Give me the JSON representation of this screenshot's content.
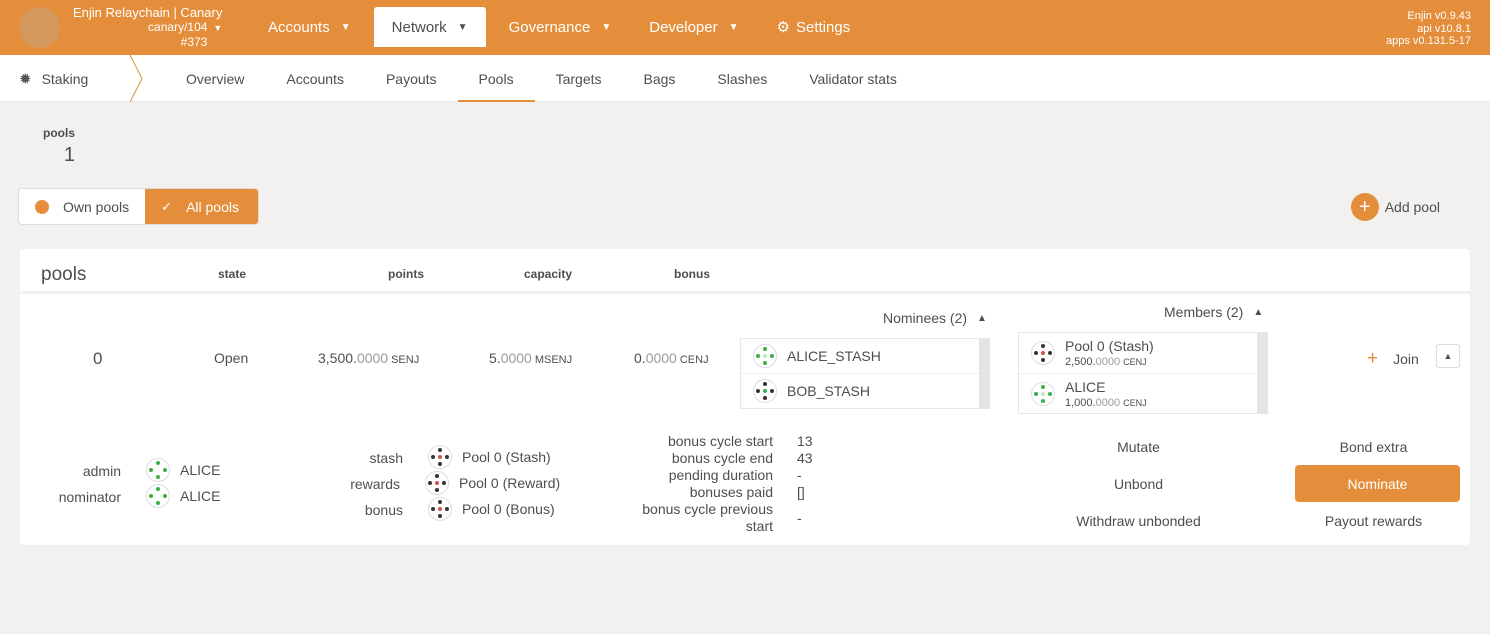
{
  "header": {
    "chain_name": "Enjin Relaychain | Canary",
    "runtime": "canary/104",
    "block": "#373",
    "menu": [
      {
        "label": "Accounts"
      },
      {
        "label": "Network"
      },
      {
        "label": "Governance"
      },
      {
        "label": "Developer"
      },
      {
        "label": "Settings"
      }
    ],
    "versions": [
      "Enjin v0.9.43",
      "api v10.8.1",
      "apps v0.131.5-17"
    ],
    "accent_color": "#e48e3b"
  },
  "subnav": {
    "section": "Staking",
    "tabs": [
      "Overview",
      "Accounts",
      "Payouts",
      "Pools",
      "Targets",
      "Bags",
      "Slashes",
      "Validator stats"
    ],
    "active_tab": "Pools"
  },
  "summary": {
    "label": "pools",
    "value": "1"
  },
  "filter": {
    "own": "Own pools",
    "all": "All pools",
    "selected": "All pools"
  },
  "add_pool": "Add pool",
  "table": {
    "title": "pools",
    "headers": {
      "state": "state",
      "points": "points",
      "capacity": "capacity",
      "bonus": "bonus"
    },
    "row": {
      "id": "0",
      "state": "Open",
      "points": {
        "int": "3,500.",
        "dec": "0000",
        "unit": "SENJ"
      },
      "capacity": {
        "int": "5.",
        "dec": "0000",
        "unit": "MSENJ"
      },
      "bonus": {
        "int": "0.",
        "dec": "0000",
        "unit": "CENJ"
      },
      "nominees_label": "Nominees (2)",
      "nominees": [
        "ALICE_STASH",
        "BOB_STASH"
      ],
      "members_label": "Members (2)",
      "members": [
        {
          "name": "Pool 0 (Stash)",
          "int": "2,500.",
          "dec": "0000",
          "unit": "CENJ"
        },
        {
          "name": "ALICE",
          "int": "1,000.",
          "dec": "0000",
          "unit": "CENJ"
        }
      ],
      "join": "Join"
    },
    "details": {
      "roles": {
        "admin_label": "admin",
        "admin": "ALICE",
        "nominator_label": "nominator",
        "nominator": "ALICE"
      },
      "accounts": {
        "stash_label": "stash",
        "stash": "Pool 0 (Stash)",
        "rewards_label": "rewards",
        "rewards": "Pool 0 (Reward)",
        "bonus_label": "bonus",
        "bonus": "Pool 0 (Bonus)"
      },
      "bonus_info": {
        "cycle_start_label": "bonus cycle start",
        "cycle_start": "13",
        "cycle_end_label": "bonus cycle end",
        "cycle_end": "43",
        "pending_label": "pending duration",
        "pending": "-",
        "paid_label": "bonuses paid",
        "paid": "[]",
        "prev_label_1": "bonus cycle previous",
        "prev_label_2": "start",
        "prev": "-"
      },
      "actions": {
        "mutate": "Mutate",
        "bond_extra": "Bond extra",
        "unbond": "Unbond",
        "nominate": "Nominate",
        "withdraw": "Withdraw unbonded",
        "payout": "Payout rewards"
      }
    }
  }
}
